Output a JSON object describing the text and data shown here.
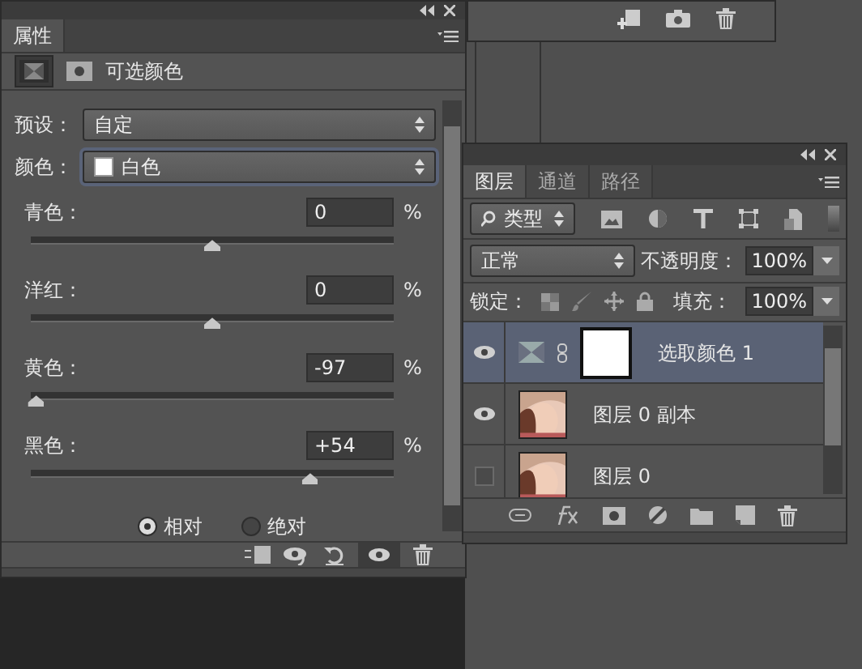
{
  "properties_panel": {
    "tab": "属性",
    "adjustment_title": "可选颜色",
    "preset_label": "预设：",
    "preset_value": "自定",
    "color_label": "颜色：",
    "color_value": "白色",
    "sliders": [
      {
        "label": "青色：",
        "value": "0",
        "unit": "%",
        "level": 0.5
      },
      {
        "label": "洋红：",
        "value": "0",
        "unit": "%",
        "level": 0.5
      },
      {
        "label": "黄色：",
        "value": "-97",
        "unit": "%",
        "level": 0.015
      },
      {
        "label": "黑色：",
        "value": "+54",
        "unit": "%",
        "level": 0.77
      }
    ],
    "methods": [
      {
        "label": "相对",
        "selected": true
      },
      {
        "label": "绝对",
        "selected": false
      }
    ]
  },
  "layers_panel": {
    "tabs": [
      {
        "label": "图层",
        "selected": true
      },
      {
        "label": "通道",
        "selected": false
      },
      {
        "label": "路径",
        "selected": false
      }
    ],
    "filter_kind": "类型",
    "blend_mode": "正常",
    "opacity_label": "不透明度：",
    "opacity_value": "100%",
    "lock_label": "锁定：",
    "fill_label": "填充：",
    "fill_value": "100%",
    "layers": [
      {
        "name": "选取颜色 1",
        "kind": "adjustment",
        "visible": true,
        "selected": true
      },
      {
        "name": "图层 0 副本",
        "kind": "picture",
        "visible": true,
        "selected": false
      },
      {
        "name": "图层 0",
        "kind": "picture",
        "visible": false,
        "selected": false
      }
    ]
  }
}
